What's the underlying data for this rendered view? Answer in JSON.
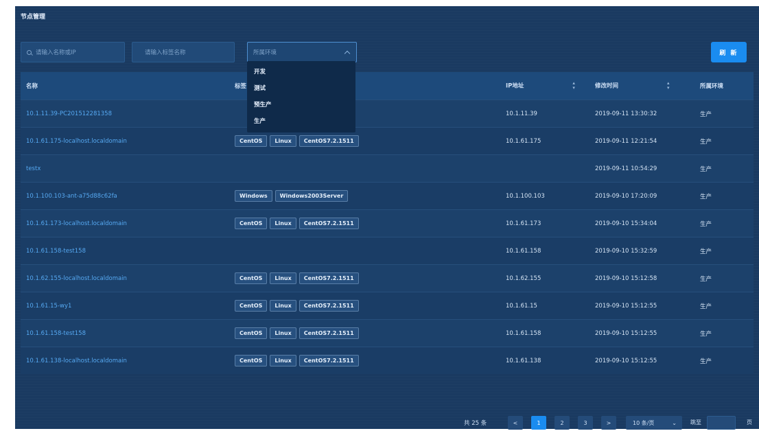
{
  "page": {
    "title": "节点管理"
  },
  "toolbar": {
    "search_placeholder": "请输入名称或IP",
    "tag_placeholder": "请输入标签名称",
    "env_placeholder": "所属环境",
    "refresh_label": "刷 新"
  },
  "env_dropdown": {
    "options": [
      "开发",
      "测试",
      "预生产",
      "生产"
    ]
  },
  "table": {
    "headers": {
      "name": "名称",
      "tags": "标签",
      "ip": "IP地址",
      "modified": "修改时间",
      "env": "所属环境"
    },
    "rows": [
      {
        "name": "10.1.11.39-PC201512281358",
        "tags": [],
        "ip": "10.1.11.39",
        "modified": "2019-09-11 13:30:32",
        "env": "生产"
      },
      {
        "name": "10.1.61.175-localhost.localdomain",
        "tags": [
          "CentOS",
          "Linux",
          "CentOS7.2.1511"
        ],
        "ip": "10.1.61.175",
        "modified": "2019-09-11 12:21:54",
        "env": "生产"
      },
      {
        "name": "testx",
        "tags": [],
        "ip": "",
        "modified": "2019-09-11 10:54:29",
        "env": "生产"
      },
      {
        "name": "10.1.100.103-ant-a75d88c62fa",
        "tags": [
          "Windows",
          "Windows2003Server"
        ],
        "ip": "10.1.100.103",
        "modified": "2019-09-10 17:20:09",
        "env": "生产"
      },
      {
        "name": "10.1.61.173-localhost.localdomain",
        "tags": [
          "CentOS",
          "Linux",
          "CentOS7.2.1511"
        ],
        "ip": "10.1.61.173",
        "modified": "2019-09-10 15:34:04",
        "env": "生产"
      },
      {
        "name": "10.1.61.158-test158",
        "tags": [],
        "ip": "10.1.61.158",
        "modified": "2019-09-10 15:32:59",
        "env": "生产"
      },
      {
        "name": "10.1.62.155-localhost.localdomain",
        "tags": [
          "CentOS",
          "Linux",
          "CentOS7.2.1511"
        ],
        "ip": "10.1.62.155",
        "modified": "2019-09-10 15:12:58",
        "env": "生产"
      },
      {
        "name": "10.1.61.15-wy1",
        "tags": [
          "CentOS",
          "Linux",
          "CentOS7.2.1511"
        ],
        "ip": "10.1.61.15",
        "modified": "2019-09-10 15:12:55",
        "env": "生产"
      },
      {
        "name": "10.1.61.158-test158",
        "tags": [
          "CentOS",
          "Linux",
          "CentOS7.2.1511"
        ],
        "ip": "10.1.61.158",
        "modified": "2019-09-10 15:12:55",
        "env": "生产"
      },
      {
        "name": "10.1.61.138-localhost.localdomain",
        "tags": [
          "CentOS",
          "Linux",
          "CentOS7.2.1511"
        ],
        "ip": "10.1.61.138",
        "modified": "2019-09-10 15:12:55",
        "env": "生产"
      }
    ]
  },
  "pagination": {
    "total_label": "共 25 条",
    "prev": "<",
    "pages": [
      "1",
      "2",
      "3"
    ],
    "active_page": "1",
    "next": ">",
    "page_size": "10 条/页",
    "goto_label": "跳至",
    "page_unit": "页"
  },
  "colors": {
    "accent": "#1a8cf0",
    "panel_bg": "#1a3a61",
    "link": "#56a9f2"
  }
}
